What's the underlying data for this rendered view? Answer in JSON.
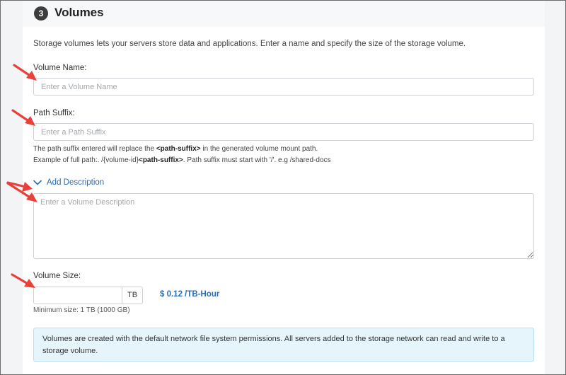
{
  "section": {
    "step_number": "3",
    "title": "Volumes",
    "intro": "Storage volumes lets your servers store data and applications. Enter a name and specify the size of the storage volume."
  },
  "volume_name": {
    "label": "Volume Name:",
    "placeholder": "Enter a Volume Name",
    "value": ""
  },
  "path_suffix": {
    "label": "Path Suffix:",
    "placeholder": "Enter a Path Suffix",
    "value": "",
    "help_line1_pre": "The path suffix entered will replace the ",
    "help_line1_bold": "<path-suffix>",
    "help_line1_post": " in the generated volume mount path.",
    "help_line2_pre": "Example of full path:. /{volume-id}",
    "help_line2_bold": "<path-suffix>",
    "help_line2_post": ". Path suffix must start with '/'. e.g /shared-docs"
  },
  "description": {
    "toggle_label": "Add Description",
    "toggle_icon": "chevron-down-icon",
    "placeholder": "Enter a Volume Description",
    "value": ""
  },
  "volume_size": {
    "label": "Volume Size:",
    "value": "",
    "unit": "TB",
    "price": "$ 0.12 /TB-Hour",
    "min_size": "Minimum size: 1 TB (1000 GB)"
  },
  "info": {
    "text": "Volumes are created with the default network file system permissions. All servers added to the storage network can read and write to a storage volume."
  },
  "colors": {
    "accent_link": "#2a6cb8",
    "annotation_arrow": "#e8413a",
    "info_background": "#e6f4fc",
    "step_badge": "#3d3d3d"
  }
}
